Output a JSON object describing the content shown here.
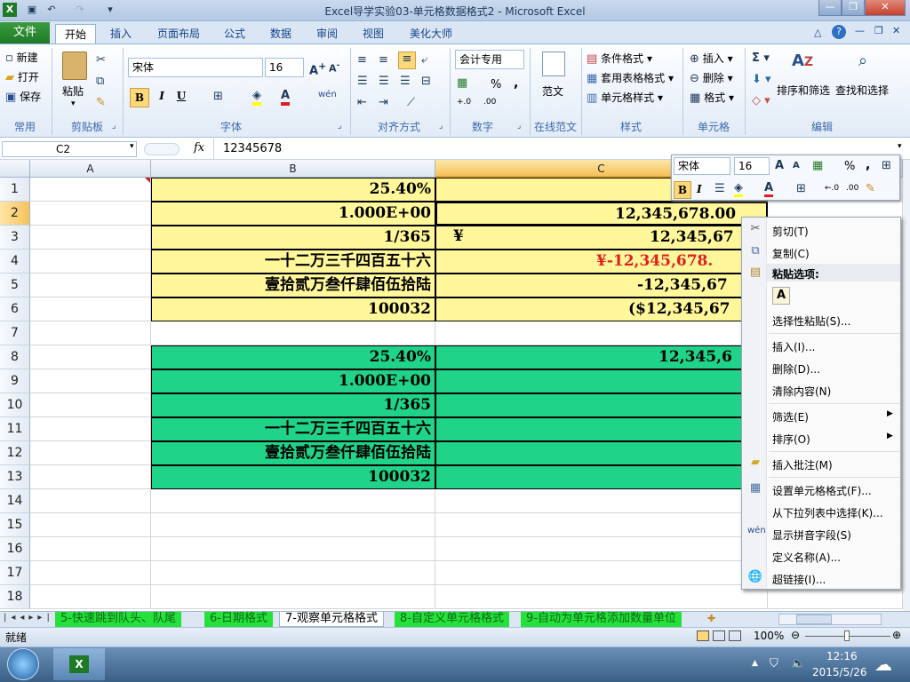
{
  "window": {
    "title": "Excel导学实验03-单元格数据格式2 - Microsoft Excel",
    "minimize": "—",
    "restore": "❐",
    "close": "✕"
  },
  "ribbon_tabs": [
    "文件",
    "开始",
    "插入",
    "页面布局",
    "公式",
    "数据",
    "审阅",
    "视图",
    "美化大师"
  ],
  "ribbon": {
    "common": {
      "new": "新建",
      "open": "打开",
      "save": "保存",
      "label": "常用"
    },
    "clipboard": {
      "paste": "粘贴",
      "label": "剪贴板"
    },
    "font": {
      "name": "宋体",
      "size": "16",
      "bold": "B",
      "italic": "I",
      "underline": "U",
      "label": "字体",
      "phonetic": "wén"
    },
    "alignment": {
      "label": "对齐方式"
    },
    "number": {
      "format": "会计专用",
      "percent": "%",
      "comma": ",",
      "label": "数字",
      "inc": "+.0",
      "dec": ".00"
    },
    "template": {
      "text": "范文",
      "label": "在线范文"
    },
    "styles": {
      "conditional": "条件格式",
      "table": "套用表格格式",
      "cell": "单元格样式",
      "label": "样式"
    },
    "cells": {
      "insert": "插入",
      "delete": "删除",
      "format": "格式",
      "label": "单元格"
    },
    "editing": {
      "sort": "排序和筛选",
      "find": "查找和选择",
      "label": "编辑"
    }
  },
  "formula_bar": {
    "name_box": "C2",
    "fx": "fx",
    "value": "12345678"
  },
  "columns": [
    "A",
    "B",
    "C"
  ],
  "rows": [
    "1",
    "2",
    "3",
    "4",
    "5",
    "6",
    "7",
    "8",
    "9",
    "10",
    "11",
    "12",
    "13",
    "14",
    "15",
    "16",
    "17",
    "18"
  ],
  "cells_b": [
    "25.40%",
    "1.000E+00",
    "1/365",
    "一十二万三千四百五十六",
    "壹拾贰万叁仟肆佰伍拾陆",
    "100032",
    "",
    "25.40%",
    "1.000E+00",
    "1/365",
    "一十二万三千四百五十六",
    "壹拾贰万叁仟肆佰伍拾陆",
    "100032"
  ],
  "cells_c": [
    "1",
    "12,345,678.00",
    "12,345,67",
    "¥-12,345,678.",
    "-12,345,67",
    "($12,345,67",
    "",
    "12,345,6"
  ],
  "cell_c3_symbol": "¥",
  "sheet_tabs": [
    "5-快速跳到队头、队尾",
    "6-日期格式",
    "7-观察单元格格式",
    "8-自定义单元格格式",
    "9-自动为单元格添加数量单位"
  ],
  "status": {
    "ready": "就绪",
    "zoom": "100%"
  },
  "taskbar": {
    "time": "12:16",
    "date": "2015/5/26"
  },
  "mini_toolbar": {
    "font": "宋体",
    "size": "16",
    "bold": "B",
    "italic": "I",
    "percent": "%",
    "comma": ","
  },
  "context_menu": {
    "cut": "剪切(T)",
    "copy": "复制(C)",
    "paste_options": "粘贴选项:",
    "paste_a": "A",
    "paste_special": "选择性粘贴(S)...",
    "insert": "插入(I)...",
    "delete": "删除(D)...",
    "clear": "清除内容(N)",
    "filter": "筛选(E)",
    "sort": "排序(O)",
    "insert_comment": "插入批注(M)",
    "format_cells": "设置单元格格式(F)...",
    "pick_list": "从下拉列表中选择(K)...",
    "phonetic": "显示拼音字段(S)",
    "define_name": "定义名称(A)...",
    "hyperlink": "超链接(I)..."
  },
  "colors": {
    "yellow": "#fff79a",
    "green": "#1fd488",
    "red_text": "#e02020",
    "file_tab": "#2a8a30"
  }
}
